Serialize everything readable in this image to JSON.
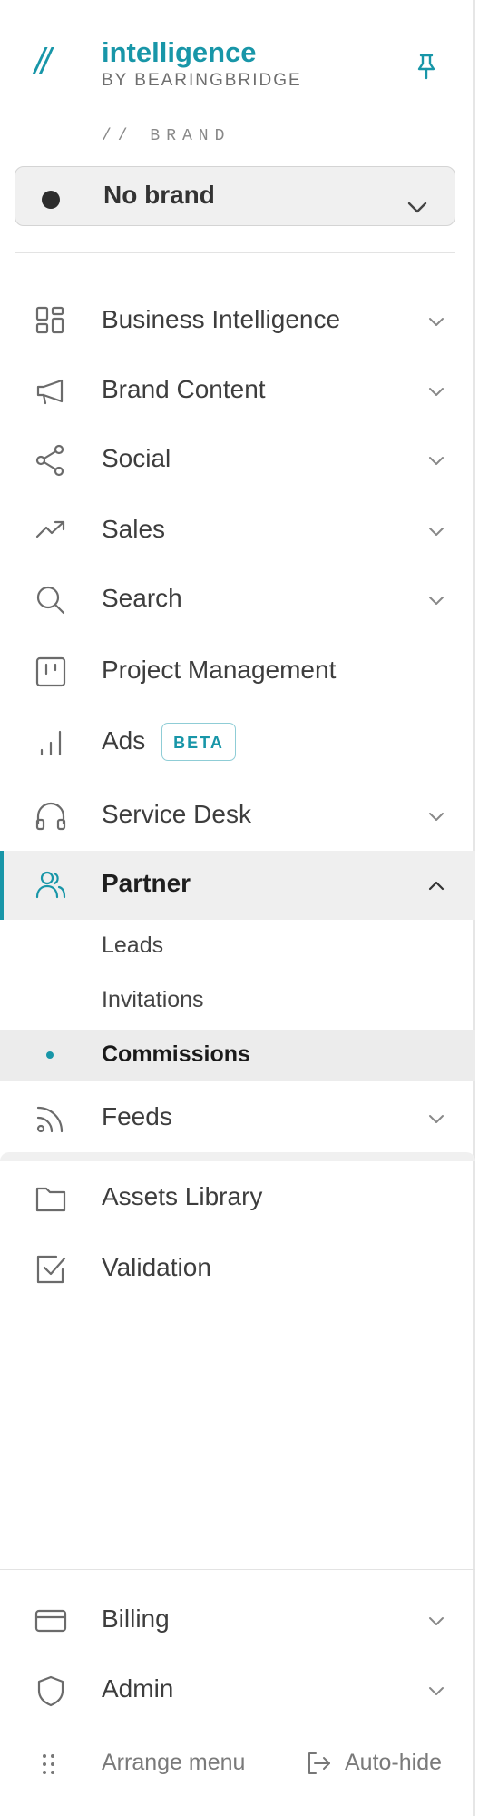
{
  "app": {
    "logo_mark": "//",
    "name": "intelligence",
    "subtitle": "BY BEARINGBRIDGE"
  },
  "brand_section": {
    "label": "// BRAND",
    "selected_value": "No brand"
  },
  "nav": {
    "items": [
      {
        "label": "Business Intelligence",
        "icon": "dashboard-grid-icon",
        "expandable": true
      },
      {
        "label": "Brand Content",
        "icon": "megaphone-icon",
        "expandable": true
      },
      {
        "label": "Social",
        "icon": "share-icon",
        "expandable": true
      },
      {
        "label": "Sales",
        "icon": "trending-up-icon",
        "expandable": true
      },
      {
        "label": "Search",
        "icon": "search-icon",
        "expandable": true
      },
      {
        "label": "Project Management",
        "icon": "kanban-icon",
        "expandable": false
      },
      {
        "label": "Ads",
        "icon": "bar-chart-icon",
        "expandable": false,
        "badge": "BETA"
      },
      {
        "label": "Service Desk",
        "icon": "headphones-icon",
        "expandable": true
      },
      {
        "label": "Partner",
        "icon": "users-icon",
        "expandable": true,
        "expanded": true,
        "active": true
      },
      {
        "label": "Feeds",
        "icon": "rss-icon",
        "expandable": true
      },
      {
        "label": "Assets Library",
        "icon": "folder-icon",
        "expandable": false
      },
      {
        "label": "Validation",
        "icon": "checkbox-icon",
        "expandable": false
      }
    ],
    "partner_subitems": [
      {
        "label": "Leads"
      },
      {
        "label": "Invitations"
      },
      {
        "label": "Commissions",
        "active": true
      }
    ]
  },
  "bottom_nav": {
    "items": [
      {
        "label": "Billing",
        "icon": "credit-card-icon",
        "expandable": true
      },
      {
        "label": "Admin",
        "icon": "shield-icon",
        "expandable": true
      }
    ]
  },
  "footer": {
    "arrange_label": "Arrange menu",
    "autohide_label": "Auto-hide"
  },
  "colors": {
    "accent": "#1896a8",
    "active_bg": "#efefef",
    "text": "#3d3d3d",
    "icon": "#6b6b6b"
  }
}
